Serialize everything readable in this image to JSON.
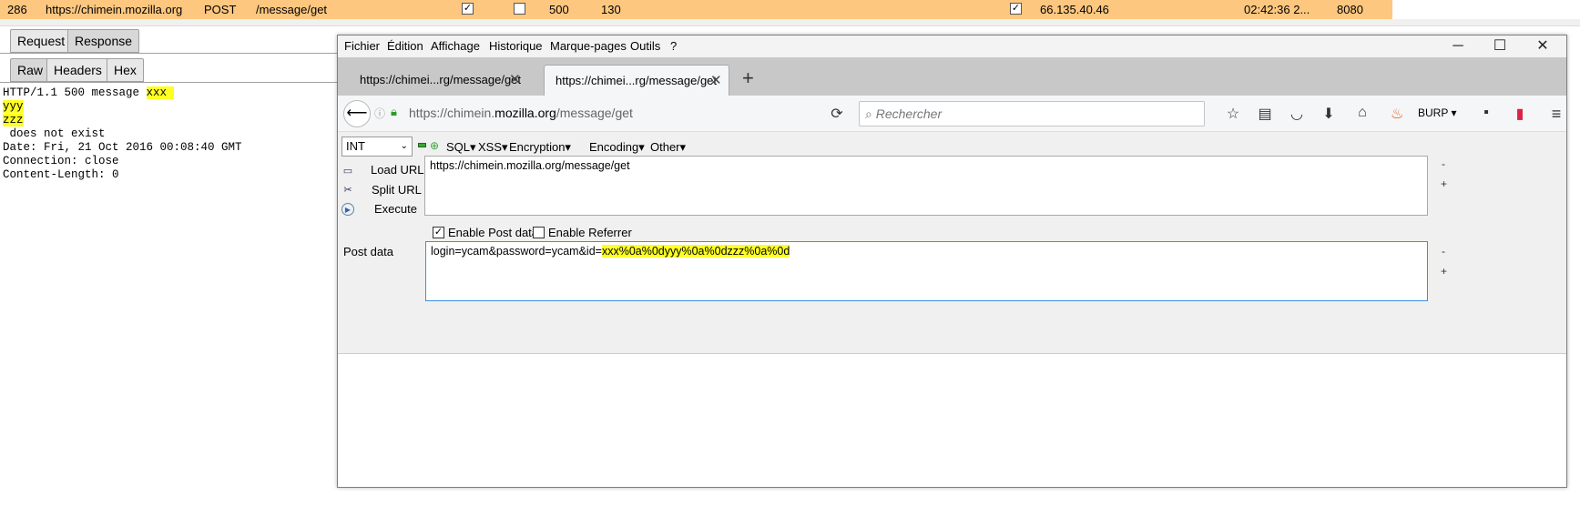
{
  "burp_row": {
    "id": "286",
    "host": "https://chimein.mozilla.org",
    "method": "POST",
    "path": "/message/get",
    "params_checked": "✓",
    "edited_checked": "",
    "status": "500",
    "length": "130",
    "ssl_checked": "✓",
    "ip": "66.135.40.46",
    "time": "02:42:36 2...",
    "port": "8080",
    "row_color": "#fec77f"
  },
  "burp_tabs": {
    "request": "Request",
    "response": "Response",
    "raw": "Raw",
    "headers": "Headers",
    "hex": "Hex"
  },
  "response": {
    "line1_pre": "HTTP/1.1 500 message ",
    "line1_hl": "xxx ",
    "line2_hl": "yyy",
    "line3_hl": "zzz",
    "line4": " does not exist",
    "line5": "Date: Fri, 21 Oct 2016 00:08:40 GMT",
    "line6": "Connection: close",
    "line7": "Content-Length: 0"
  },
  "firefox": {
    "menu": [
      "Fichier",
      "Édition",
      "Affichage",
      "Historique",
      "Marque-pages",
      "Outils",
      "?"
    ],
    "window_controls": {
      "minimize": "─",
      "maximize": "☐",
      "close": "✕"
    },
    "tabs": [
      {
        "label": "https://chimei...rg/message/get",
        "active": false
      },
      {
        "label": "https://chimei...rg/message/get",
        "active": true
      }
    ],
    "new_tab": "+",
    "url_prefix": "https://chimein.",
    "url_domain": "mozilla.org",
    "url_suffix": "/message/get",
    "search_placeholder": "Rechercher",
    "burp_label": "BURP",
    "hackbar": {
      "select_value": "INT",
      "menus": [
        "SQL",
        "XSS",
        "Encryption",
        "Encoding",
        "Other"
      ],
      "load_url": "Load URL",
      "split_url": "Split URL",
      "execute": "Execute",
      "url_value": "https://chimein.mozilla.org/message/get",
      "enable_post": "Enable Post data",
      "enable_referrer": "Enable Referrer",
      "post_label": "Post data",
      "post_value_pre": "login=ycam&password=ycam&id=",
      "post_value_hl": "xxx%0a%0dyyy%0a%0dzzz%0a%0d",
      "minus": "-",
      "plus": "+"
    }
  }
}
